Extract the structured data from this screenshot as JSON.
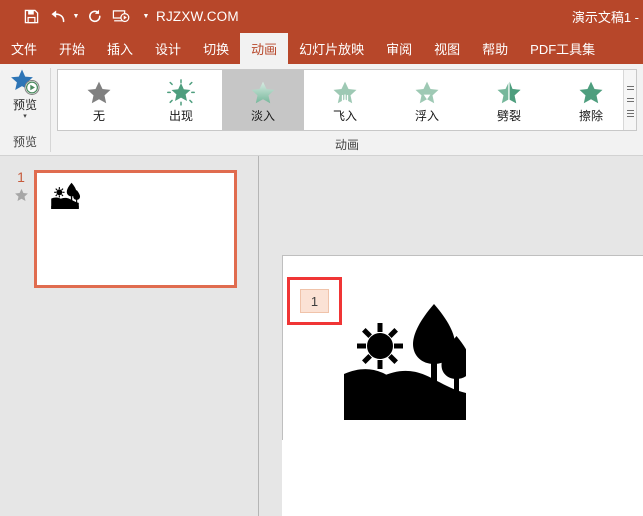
{
  "titlebar": {
    "quick_access": [
      {
        "name": "save-icon",
        "label": "保存"
      },
      {
        "name": "undo-icon",
        "label": "撤消"
      },
      {
        "name": "redo-icon",
        "label": "恢复"
      },
      {
        "name": "start-slideshow-icon",
        "label": "从头开始"
      },
      {
        "name": "customize-qat-caret-icon",
        "label": "自定义快速访问工具栏"
      }
    ],
    "brand": "RJZXW.COM",
    "document_title": "演示文稿1  -",
    "accent_color": "#b7472a"
  },
  "tabs": [
    {
      "label": "文件",
      "active": false
    },
    {
      "label": "开始",
      "active": false
    },
    {
      "label": "插入",
      "active": false
    },
    {
      "label": "设计",
      "active": false
    },
    {
      "label": "切换",
      "active": false
    },
    {
      "label": "动画",
      "active": true
    },
    {
      "label": "幻灯片放映",
      "active": false
    },
    {
      "label": "审阅",
      "active": false
    },
    {
      "label": "视图",
      "active": false
    },
    {
      "label": "帮助",
      "active": false
    },
    {
      "label": "PDF工具集",
      "active": false
    }
  ],
  "ribbon": {
    "preview_group": {
      "button_label": "预览",
      "group_label": "预览",
      "icon": "preview-star-play-icon",
      "caret": "▾"
    },
    "animation_group": {
      "group_label": "动画",
      "items": [
        {
          "label": "无",
          "icon": "star-none-icon",
          "selected": false
        },
        {
          "label": "出现",
          "icon": "star-appear-icon",
          "selected": false
        },
        {
          "label": "淡入",
          "icon": "star-fade-icon",
          "selected": true
        },
        {
          "label": "飞入",
          "icon": "star-flyin-icon",
          "selected": false
        },
        {
          "label": "浮入",
          "icon": "star-floatin-icon",
          "selected": false
        },
        {
          "label": "劈裂",
          "icon": "star-split-icon",
          "selected": false
        },
        {
          "label": "擦除",
          "icon": "star-wipe-icon",
          "selected": false
        }
      ]
    }
  },
  "thumbnail_pane": {
    "slides": [
      {
        "number": "1",
        "has_animation_indicator": true,
        "selected": true,
        "artwork": "landscape-sun-trees-icon",
        "selection_color": "#e06c4f"
      }
    ]
  },
  "slide_canvas": {
    "animation_tag": "1",
    "animation_tag_highlight_color": "#f03535",
    "artwork": "landscape-sun-trees-icon"
  }
}
